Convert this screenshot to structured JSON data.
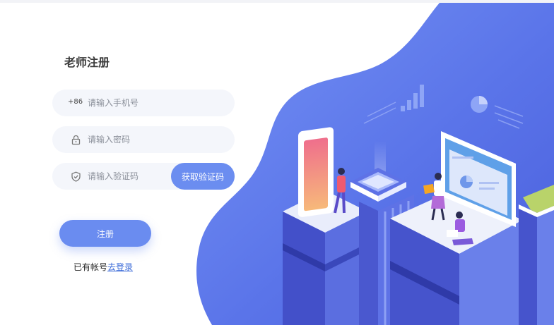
{
  "form": {
    "title": "老师注册",
    "phone": {
      "prefix": "+86",
      "placeholder": "请输入手机号"
    },
    "password": {
      "placeholder": "请输入密码"
    },
    "code": {
      "placeholder": "请输入验证码",
      "button_label": "获取验证码"
    },
    "submit_label": "注册",
    "login_prompt": "已有帐号",
    "login_link": "去登录"
  },
  "colors": {
    "primary": "#6b8df0",
    "field_bg": "#f4f6fb",
    "art_blue": "#5b78ec",
    "link": "#3a6ad8"
  },
  "icons": [
    "lock-icon",
    "shield-check-icon"
  ]
}
